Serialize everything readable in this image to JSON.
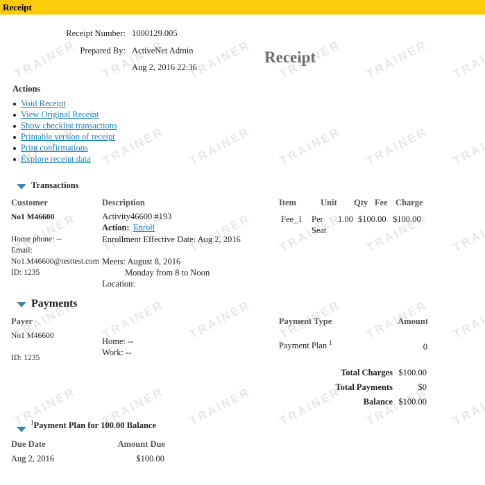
{
  "top_bar": {
    "title": "Receipt"
  },
  "watermark": "TRAINER",
  "receipt_info": {
    "number_label": "Receipt Number:",
    "number_value": "1000129.005",
    "prepared_by_label": "Prepared By:",
    "prepared_by_value": "ActiveNet Admin",
    "date_value": "Aug 2, 2016 22:36"
  },
  "page_title": "Receipt",
  "actions": {
    "heading": "Actions",
    "items": [
      "Void Receipt",
      "View Original Receipt",
      "Show checklist transactions",
      "Printable version of receipt",
      "Print confirmations",
      "Explore receipt data"
    ]
  },
  "transactions": {
    "heading": "Transactions",
    "columns": {
      "customer": "Customer",
      "description": "Description",
      "item": "Item",
      "unit": "Unit",
      "qty": "Qty",
      "fee": "Fee",
      "charge": "Charge"
    },
    "customer": {
      "name": "No1 M46600",
      "home_phone": "Home phone: --",
      "email_label": "Email:",
      "email": "No1.M46600@testtest.com",
      "id": "ID: 1235"
    },
    "description": {
      "activity": "Activity46600 #193",
      "action_label": "Action:",
      "action_link": "Enroll",
      "effective": "Enrollment Effective Date: Aug 2, 2016",
      "meets": "Meets: August 8, 2016",
      "schedule": "Monday from 8 to Noon",
      "location": "Location:"
    },
    "row": {
      "item": "Fee_1",
      "unit_line1": "Per",
      "unit_line2": "Seat",
      "qty": "1.00",
      "fee": "$100.00",
      "charge": "$100.00"
    }
  },
  "payments": {
    "heading": "Payments",
    "columns": {
      "payer": "Payer",
      "payment_type": "Payment Type",
      "amount": "Amount"
    },
    "payer": {
      "name": "No1 M46600",
      "id": "ID: 1235",
      "home": "Home: --",
      "work": "Work: --"
    },
    "row": {
      "type": "Payment Plan",
      "footnote": "1",
      "amount": "0"
    },
    "totals": {
      "charges_label": "Total Charges",
      "charges_value": "$100.00",
      "payments_label": "Total Payments",
      "payments_value": "$0",
      "balance_label": "Balance",
      "balance_value": "$100.00"
    }
  },
  "payment_plan": {
    "footnote": "1",
    "heading": "Payment Plan for 100.00 Balance",
    "columns": {
      "due_date": "Due Date",
      "amount_due": "Amount Due"
    },
    "rows": [
      {
        "due_date": "Aug 2, 2016",
        "amount_due": "$100.00"
      }
    ]
  }
}
